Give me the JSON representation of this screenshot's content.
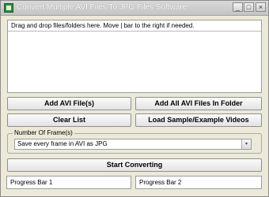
{
  "window": {
    "title": "Convert Multiple AVI Files To JPG Files Software",
    "minimize_glyph": "_",
    "maximize_glyph": "□",
    "close_glyph": "×",
    "app_icon": "app-icon"
  },
  "dropzone": {
    "header": "Drag and drop files/folders here. Move | bar to the right if needed."
  },
  "buttons": {
    "add_files": "Add AVI File(s)",
    "add_folder": "Add All AVI Files In Folder",
    "clear_list": "Clear List",
    "load_sample": "Load Sample/Example Videos",
    "start": "Start Converting"
  },
  "frames_group": {
    "legend": "Number Of Frame(s)",
    "selected_option": "Save every frame in AVI as JPG",
    "dropdown_glyph": "▾"
  },
  "progress": {
    "bar1_label": "Progress Bar 1",
    "bar2_label": "Progress Bar 2"
  },
  "colors": {
    "window_bg": "#ece9d8",
    "titlebar": "#c8c8c8",
    "button_border": "#8f8f8f"
  }
}
